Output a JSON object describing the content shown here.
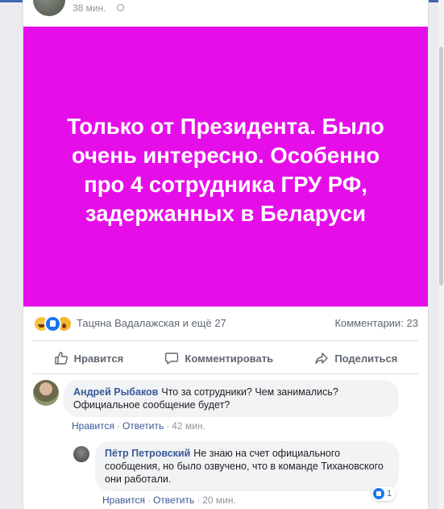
{
  "post": {
    "time": "38 мин.",
    "banner_text": "Только от Президента. Было очень интересно. Особенно про 4 сотрудника ГРУ РФ, задержанных в Беларуси",
    "banner_color": "#e50ee8",
    "reactions": {
      "icons": [
        "haha-icon",
        "like-icon",
        "wow-icon"
      ],
      "summary": "Тацяна Вадалажская и ещё 27",
      "comments_count": "Комментарии: 23"
    },
    "actions": {
      "like": "Нравится",
      "comment": "Комментировать",
      "share": "Поделиться"
    }
  },
  "comments": [
    {
      "author": "Андрей Рыбаков",
      "text": "Что за сотрудники? Чем занимались? Официальное сообщение будет?",
      "like_label": "Нравится",
      "reply_label": "Ответить",
      "time": "42 мин."
    },
    {
      "author": "Пётр Петровский",
      "text": "Не знаю на счет официального сообщения, но было озвучено, что в команде Тихановского они работали.",
      "like_label": "Нравится",
      "reply_label": "Ответить",
      "time": "20 мин.",
      "likes": "1"
    }
  ],
  "colors": {
    "accent": "#385898",
    "top_bar": "#4267b2"
  }
}
